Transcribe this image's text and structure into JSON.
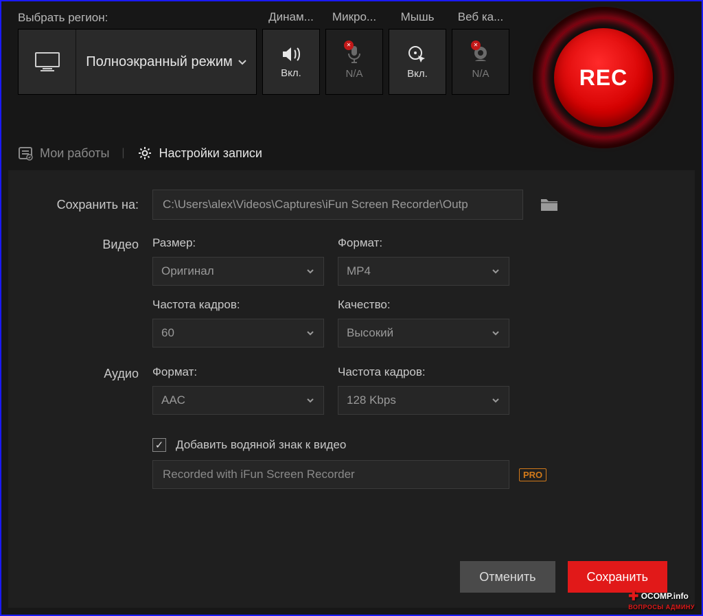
{
  "topbar": {
    "region_label": "Выбрать регион:",
    "mode_label": "Полноэкранный режим",
    "toggles": {
      "speaker": {
        "header": "Динам...",
        "state": "Вкл."
      },
      "mic": {
        "header": "Микро...",
        "state": "N/A"
      },
      "mouse": {
        "header": "Мышь",
        "state": "Вкл."
      },
      "webcam": {
        "header": "Веб ка...",
        "state": "N/A"
      }
    },
    "rec_label": "REC"
  },
  "tabs": {
    "works": "Мои работы",
    "settings": "Настройки записи"
  },
  "settings": {
    "save_to_label": "Сохранить на:",
    "save_to_path": "C:\\Users\\alex\\Videos\\Captures\\iFun Screen Recorder\\Outp",
    "video_label": "Видео",
    "audio_label": "Аудио",
    "fields": {
      "size": {
        "label": "Размер:",
        "value": "Оригинал"
      },
      "format": {
        "label": "Формат:",
        "value": "MP4"
      },
      "fps": {
        "label": "Частота кадров:",
        "value": "60"
      },
      "quality": {
        "label": "Качество:",
        "value": "Высокий"
      },
      "aformat": {
        "label": "Формат:",
        "value": "AAC"
      },
      "abitrate": {
        "label": "Частота кадров:",
        "value": "128 Kbps"
      }
    },
    "watermark_check_label": "Добавить водяной знак к видео",
    "watermark_text": "Recorded with iFun Screen Recorder",
    "pro_badge": "PRO"
  },
  "footer": {
    "cancel": "Отменить",
    "save": "Сохранить"
  },
  "site_watermark": {
    "main": "OCOMP.info",
    "sub": "ВОПРОСЫ АДМИНУ"
  }
}
